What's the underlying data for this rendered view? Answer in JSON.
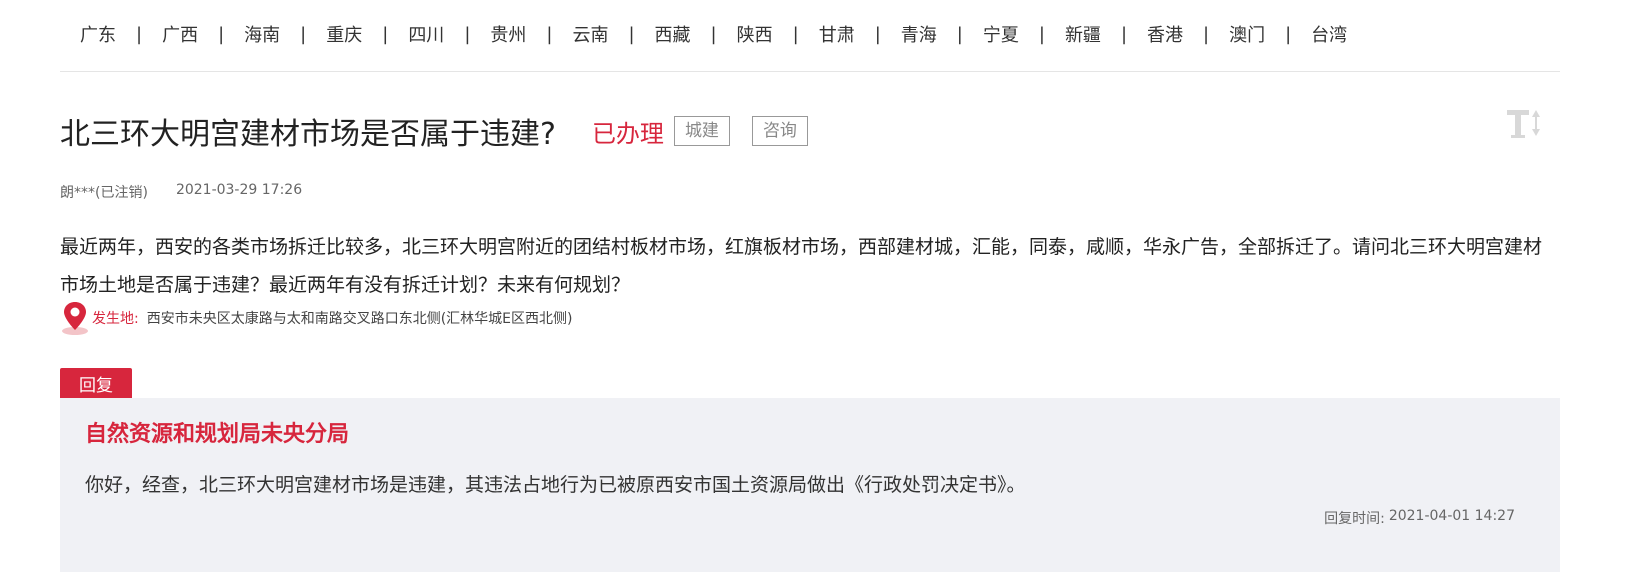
{
  "regions": [
    "广东",
    "广西",
    "海南",
    "重庆",
    "四川",
    "贵州",
    "云南",
    "西藏",
    "陕西",
    "甘肃",
    "青海",
    "宁夏",
    "新疆",
    "香港",
    "澳门",
    "台湾"
  ],
  "separator": "|",
  "article": {
    "title": "北三环大明宫建材市场是否属于违建?",
    "status": "已办理",
    "tags": [
      "城建",
      "咨询"
    ],
    "author": "朗***(已注销)",
    "date": "2021-03-29 17:26",
    "content": "最近两年，西安的各类市场拆迁比较多，北三环大明宫附近的团结村板材市场，红旗板材市场，西部建材城，汇能，同泰，咸顺，华永广告，全部拆迁了。请问北三环大明宫建材市场土地是否属于违建？最近两年有没有拆迁计划？未来有何规划？",
    "location_label": "发生地:",
    "location_value": "西安市未央区太康路与太和南路交叉路口东北侧(汇林华城E区西北侧)"
  },
  "reply": {
    "tab_label": "回复",
    "org": "自然资源和规划局未央分局",
    "content": "你好，经查，北三环大明宫建材市场是违建，其违法占地行为已被原西安市国土资源局做出《行政处罚决定书》。",
    "time_label": "回复时间:",
    "time": "2021-04-01 14:27"
  },
  "icons": {
    "font_size_toggle": "font-size-icon",
    "location": "map-pin-icon"
  },
  "colors": {
    "accent": "#d7263d",
    "reply_bg": "#f0f1f5",
    "text": "#222222"
  }
}
